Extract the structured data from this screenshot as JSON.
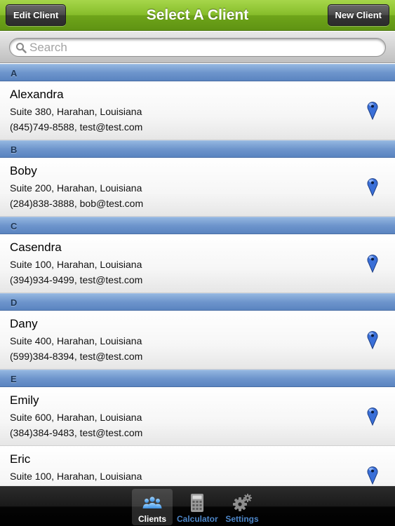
{
  "navbar": {
    "title": "Select A Client",
    "left_button": "Edit Client",
    "right_button": "New Client"
  },
  "search": {
    "placeholder": "Search",
    "value": ""
  },
  "sections": [
    {
      "letter": "A",
      "clients": [
        {
          "name": "Alexandra",
          "address": "Suite 380, Harahan, Louisiana",
          "contact": "(845)749-8588, test@test.com"
        }
      ]
    },
    {
      "letter": "B",
      "clients": [
        {
          "name": "Boby",
          "address": "Suite 200, Harahan, Louisiana",
          "contact": "(284)838-3888, bob@test.com"
        }
      ]
    },
    {
      "letter": "C",
      "clients": [
        {
          "name": "Casendra",
          "address": "Suite 100, Harahan, Louisiana",
          "contact": "(394)934-9499, test@test.com"
        }
      ]
    },
    {
      "letter": "D",
      "clients": [
        {
          "name": "Dany",
          "address": "Suite 400, Harahan, Louisiana",
          "contact": "(599)384-8394, test@test.com"
        }
      ]
    },
    {
      "letter": "E",
      "clients": [
        {
          "name": "Emily",
          "address": "Suite 600, Harahan, Louisiana",
          "contact": "(384)384-9483, test@test.com"
        },
        {
          "name": "Eric",
          "address": "Suite 100, Harahan, Louisiana",
          "contact": ""
        }
      ]
    }
  ],
  "tabs": [
    {
      "label": "Clients",
      "icon": "people-icon",
      "active": true
    },
    {
      "label": "Calculator",
      "icon": "calculator-icon",
      "active": false
    },
    {
      "label": "Settings",
      "icon": "gear-icon",
      "active": false
    }
  ],
  "colors": {
    "navbar_green": "#86bd2a",
    "section_blue": "#6e95cc",
    "pin_blue": "#3a6fd8",
    "tab_label_blue": "#4d86c8"
  }
}
